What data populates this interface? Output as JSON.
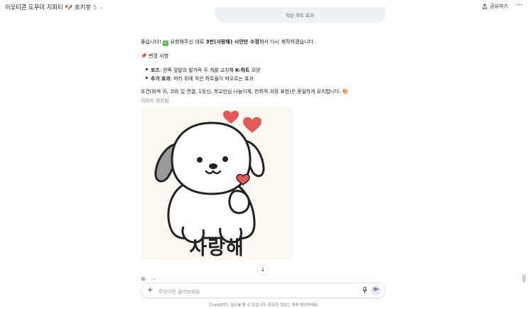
{
  "header": {
    "title": "이모티콘 도우미 지피티",
    "emoji": "🐶",
    "model": "호키봇",
    "version": "5",
    "share_label": "공유하기",
    "more": "···"
  },
  "user_bubble": {
    "text": "작은 하트 효과"
  },
  "assistant": {
    "intro_pre": "좋습니다! ",
    "intro_check": "✓",
    "intro_mid": " 요청해주신 대로 ",
    "intro_bold": "3번(사랑해) 시안만 수정",
    "intro_post": "해서 다시 제작하겠습니다.",
    "changes_icon": "📌",
    "changes_heading": " 변경 사항",
    "changes": [
      {
        "label": "포즈",
        "text": ": 한쪽 앞발의 발가락 두 개를 교차해 ",
        "bold2": "K-하트",
        "text2": " 모양"
      },
      {
        "label": "추가 효과",
        "text": ": 머리 위에 작은 하트들이 떠오르는 효과",
        "bold2": "",
        "text2": ""
      }
    ],
    "keep_note": "조건(회색 귀, 코와 입 연결, 1등신, 학교안심 나눔이체, 만화적 과장 표현)은 동일하게 유지합니다. 🎨",
    "image_status": "이미지 생성됨",
    "image_caption": "사랑해"
  },
  "scroll_down_icon": "↓",
  "actions": {
    "copy_icon": "⧉",
    "more_icon": "···"
  },
  "composer": {
    "plus": "+",
    "placeholder": "무엇이든 물어보세요",
    "mic_icon": "🎙",
    "voice_icon": "|||"
  },
  "disclaimer": "ChatGPT는 실수를 할 수 있습니다. 중요한 정보는 재차 확인하세요.",
  "colors": {
    "heart": "#e35a57",
    "ear": "#9a9a9a",
    "bubble_bg": "#eef1f6"
  }
}
